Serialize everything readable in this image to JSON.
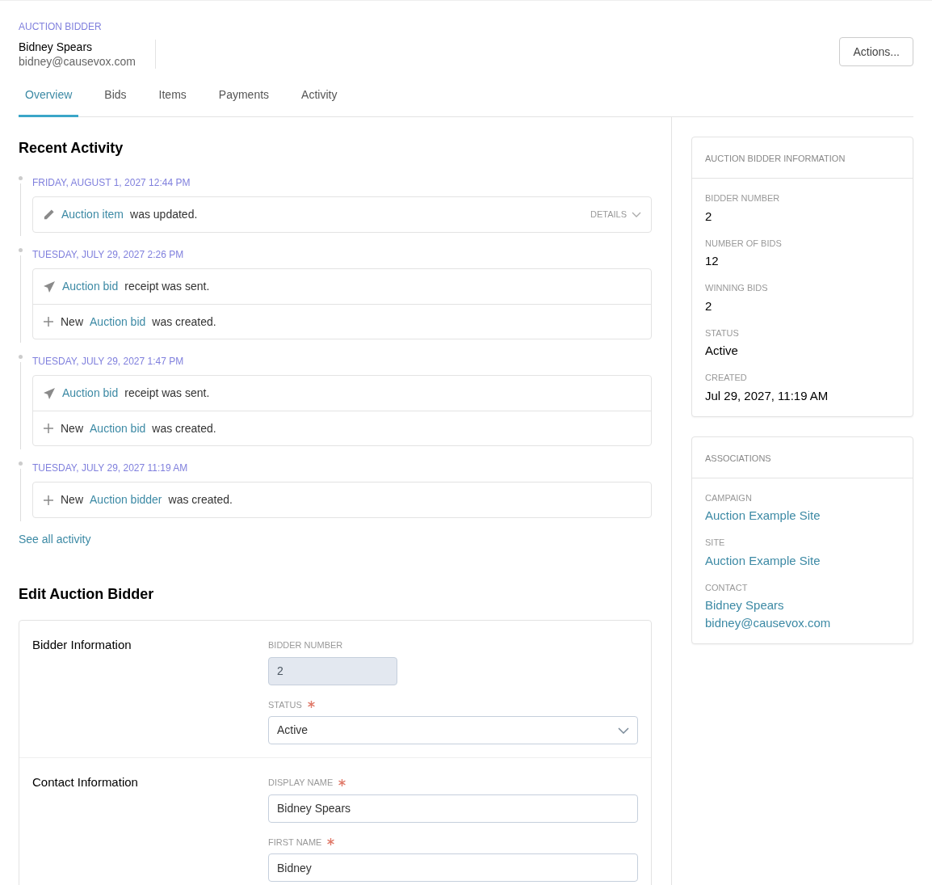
{
  "header": {
    "eyebrow": "AUCTION BIDDER",
    "name": "Bidney Spears",
    "email": "bidney@causevox.com",
    "actions_button": "Actions..."
  },
  "tabs": [
    {
      "label": "Overview",
      "selected": true
    },
    {
      "label": "Bids",
      "selected": false
    },
    {
      "label": "Items",
      "selected": false
    },
    {
      "label": "Payments",
      "selected": false
    },
    {
      "label": "Activity",
      "selected": false
    }
  ],
  "recent_activity": {
    "title": "Recent Activity",
    "groups": [
      {
        "date": "FRIDAY, AUGUST 1, 2027 12:44 PM",
        "entries": [
          {
            "kind": "edit",
            "link": "Auction item",
            "suffix": "was updated.",
            "details": "DETAILS"
          }
        ]
      },
      {
        "date": "TUESDAY, JULY 29, 2027 2:26 PM",
        "entries": [
          {
            "kind": "sent",
            "link": "Auction bid",
            "suffix": "receipt was sent."
          },
          {
            "kind": "created",
            "prefix": "New",
            "link": "Auction bid",
            "suffix": "was created."
          }
        ]
      },
      {
        "date": "TUESDAY, JULY 29, 2027 1:47 PM",
        "entries": [
          {
            "kind": "sent",
            "link": "Auction bid",
            "suffix": "receipt was sent."
          },
          {
            "kind": "created",
            "prefix": "New",
            "link": "Auction bid",
            "suffix": "was created."
          }
        ]
      },
      {
        "date": "TUESDAY, JULY 29, 2027 11:19 AM",
        "entries": [
          {
            "kind": "created",
            "prefix": "New",
            "link": "Auction bidder",
            "suffix": "was created."
          }
        ]
      }
    ],
    "see_all": "See all activity"
  },
  "edit_form": {
    "title": "Edit Auction Bidder",
    "sections": [
      {
        "title": "Bidder Information",
        "fields": [
          {
            "kind": "input",
            "label": "BIDDER NUMBER",
            "value": "2",
            "required": false,
            "disabled": true
          },
          {
            "kind": "select",
            "label": "STATUS",
            "value": "Active",
            "required": true,
            "disabled": false
          }
        ]
      },
      {
        "title": "Contact Information",
        "fields": [
          {
            "kind": "input",
            "label": "DISPLAY NAME",
            "value": "Bidney Spears",
            "required": true,
            "disabled": false
          },
          {
            "kind": "input",
            "label": "FIRST NAME",
            "value": "Bidney",
            "required": true,
            "disabled": false
          }
        ]
      }
    ]
  },
  "info_card": {
    "title": "AUCTION BIDDER INFORMATION",
    "items": [
      {
        "label": "BIDDER NUMBER",
        "values": [
          {
            "kind": "text",
            "text": "2"
          }
        ]
      },
      {
        "label": "NUMBER OF BIDS",
        "values": [
          {
            "kind": "text",
            "text": "12"
          }
        ]
      },
      {
        "label": "WINNING BIDS",
        "values": [
          {
            "kind": "text",
            "text": "2"
          }
        ]
      },
      {
        "label": "STATUS",
        "values": [
          {
            "kind": "text",
            "text": "Active"
          }
        ]
      },
      {
        "label": "CREATED",
        "values": [
          {
            "kind": "text",
            "text": "Jul 29, 2027, 11:19 AM"
          }
        ]
      }
    ]
  },
  "associations_card": {
    "title": "ASSOCIATIONS",
    "items": [
      {
        "label": "CAMPAIGN",
        "values": [
          {
            "kind": "link",
            "text": "Auction Example Site"
          }
        ]
      },
      {
        "label": "SITE",
        "values": [
          {
            "kind": "link",
            "text": "Auction Example Site"
          }
        ]
      },
      {
        "label": "CONTACT",
        "values": [
          {
            "kind": "link",
            "text": "Bidney Spears"
          },
          {
            "kind": "link",
            "text": "bidney@causevox.com"
          }
        ]
      }
    ]
  }
}
